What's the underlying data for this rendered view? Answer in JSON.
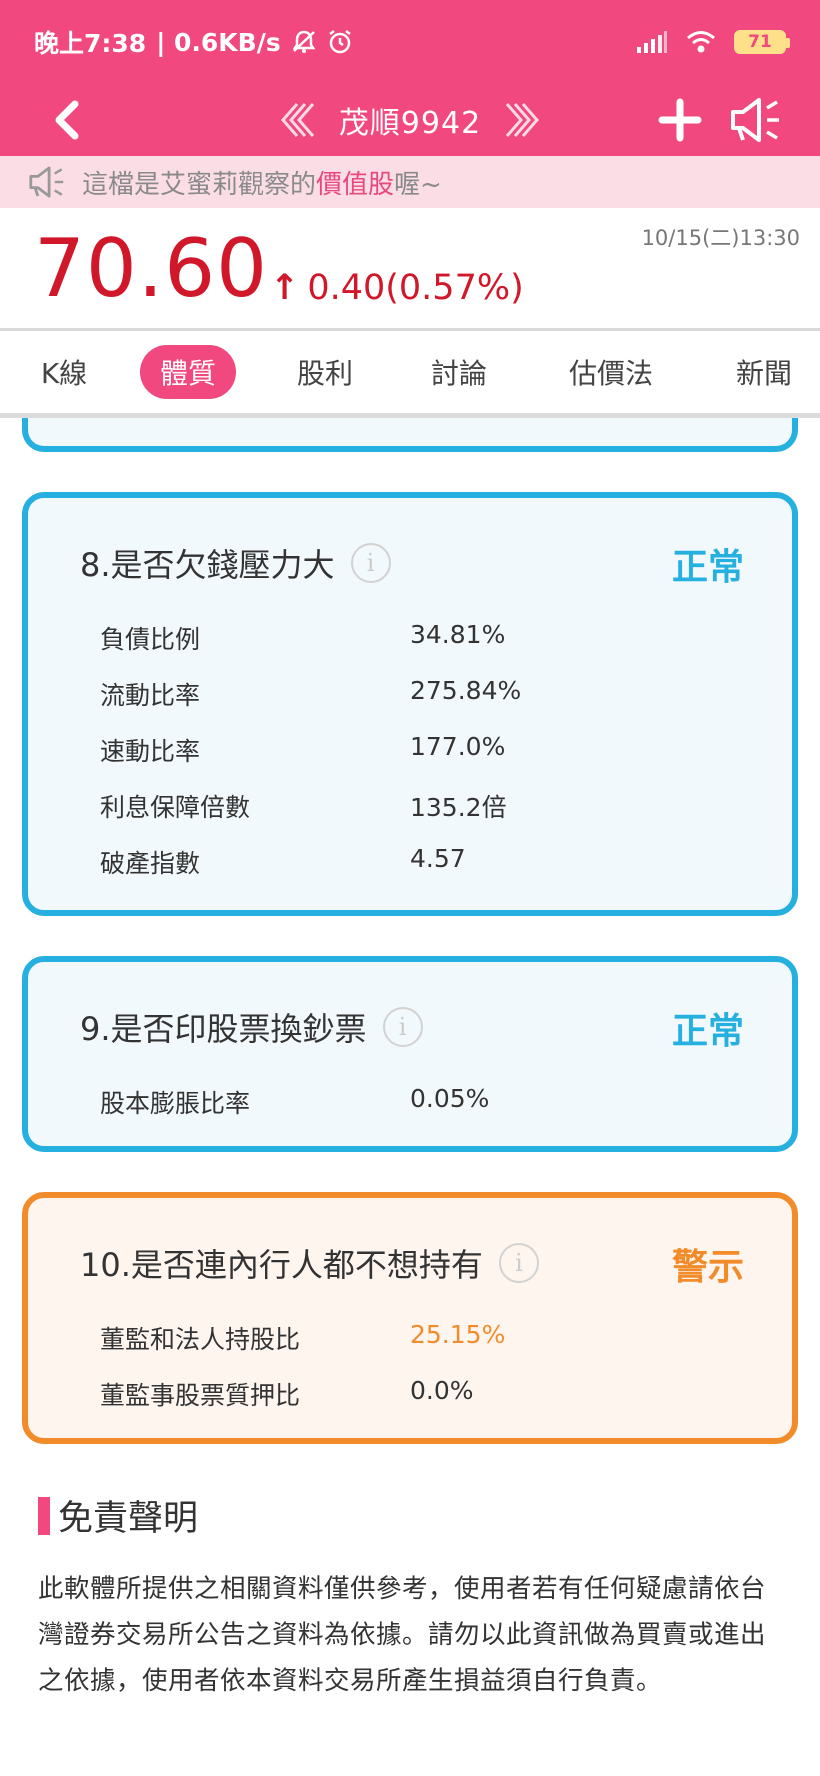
{
  "status_bar": {
    "time": "晚上7:38",
    "speed": "| 0.6KB/s",
    "battery": "71"
  },
  "nav": {
    "title": "茂順9942",
    "prev_icon": "double-chevron-left-icon",
    "next_icon": "double-chevron-right-icon"
  },
  "notice": {
    "prefix": "這檔是艾蜜莉觀察的",
    "highlight": "價值股",
    "suffix": "喔~"
  },
  "quote": {
    "price": "70.60",
    "arrow": "↑",
    "change": "0.40(0.57%)",
    "timestamp": "10/15(二)13:30"
  },
  "tabs": [
    {
      "label": "K線"
    },
    {
      "label": "體質"
    },
    {
      "label": "股利"
    },
    {
      "label": "討論"
    },
    {
      "label": "估價法"
    },
    {
      "label": "新聞"
    }
  ],
  "cards": [
    {
      "title": "8.是否欠錢壓力大",
      "status": "正常",
      "rows": [
        {
          "label": "負債比例",
          "value": "34.81%"
        },
        {
          "label": "流動比率",
          "value": "275.84%"
        },
        {
          "label": "速動比率",
          "value": "177.0%"
        },
        {
          "label": "利息保障倍數",
          "value": "135.2倍"
        },
        {
          "label": "破產指數",
          "value": "4.57"
        }
      ]
    },
    {
      "title": "9.是否印股票換鈔票",
      "status": "正常",
      "rows": [
        {
          "label": "股本膨脹比率",
          "value": "0.05%"
        }
      ]
    },
    {
      "title": "10.是否連內行人都不想持有",
      "status": "警示",
      "rows": [
        {
          "label": "董監和法人持股比",
          "value": "25.15%"
        },
        {
          "label": "董監事股票質押比",
          "value": "0.0%"
        }
      ]
    }
  ],
  "disclaimer": {
    "title": "免責聲明",
    "text": "此軟體所提供之相關資料僅供參考，使用者若有任何疑慮請依台灣證券交易所公告之資料為依據。請勿以此資訊做為買賣或進出之依據，使用者依本資料交易所產生損益須自行負責。"
  },
  "info_glyph": "i",
  "colors": {
    "brand_pink": "#f0487f",
    "price_red": "#d0182a",
    "normal_blue": "#25b0e0",
    "warn_orange": "#f28c2b"
  }
}
